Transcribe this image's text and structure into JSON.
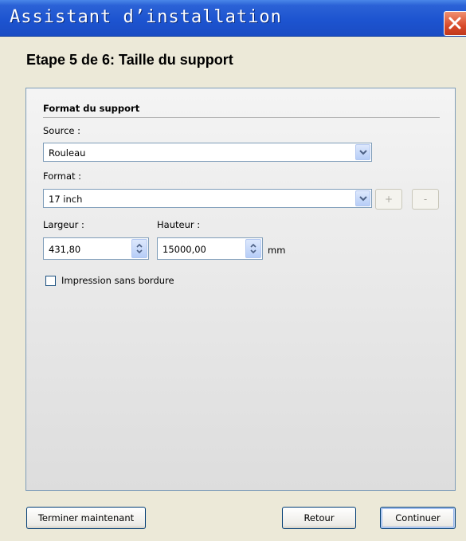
{
  "window": {
    "title": "Assistant d’installation",
    "close_icon": "close-icon"
  },
  "step_title": "Etape 5 de 6: Taille du support",
  "section": {
    "title": "Format du support"
  },
  "source": {
    "label": "Source :",
    "value": "Rouleau"
  },
  "format": {
    "label": "Format :",
    "value": "17 inch",
    "add_label": "+",
    "remove_label": "-"
  },
  "width": {
    "label": "Largeur :",
    "value": "431,80"
  },
  "height": {
    "label": "Hauteur :",
    "value": "15000,00",
    "unit": "mm"
  },
  "borderless": {
    "label": "Impression sans bordure",
    "checked": false
  },
  "footer": {
    "finish_label": "Terminer maintenant",
    "back_label": "Retour",
    "next_label": "Continuer"
  },
  "colors": {
    "titlebar": "#1d54d0",
    "close": "#d94a2a",
    "window_bg": "#ece9d8",
    "field_border": "#7f9db9"
  }
}
